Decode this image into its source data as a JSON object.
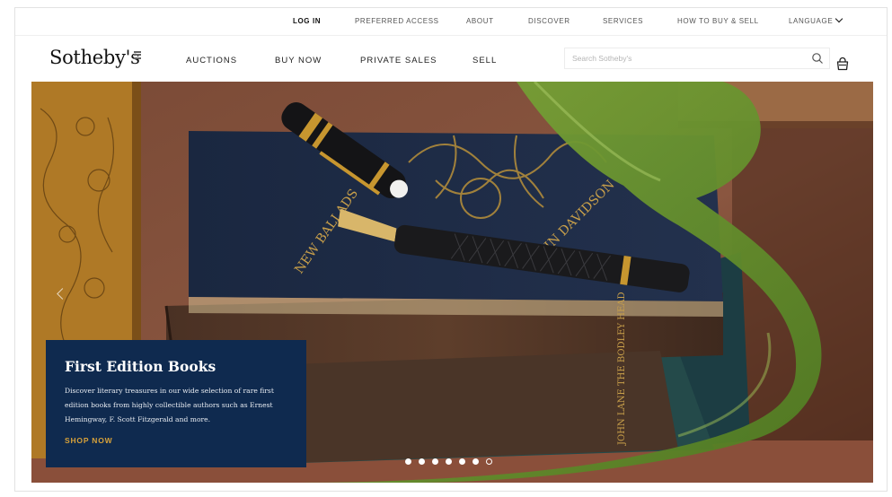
{
  "utility_nav": [
    {
      "label": "LOG IN"
    },
    {
      "label": "PREFERRED ACCESS"
    },
    {
      "label": "ABOUT"
    },
    {
      "label": "DISCOVER"
    },
    {
      "label": "SERVICES"
    },
    {
      "label": "HOW TO BUY & SELL"
    },
    {
      "label": "LANGUAGE"
    }
  ],
  "brand": {
    "name": "Sotheby's"
  },
  "main_nav": [
    {
      "label": "AUCTIONS"
    },
    {
      "label": "BUY NOW"
    },
    {
      "label": "PRIVATE SALES"
    },
    {
      "label": "SELL"
    }
  ],
  "search": {
    "placeholder": "Search Sotheby's",
    "icon": "search-icon"
  },
  "cart": {
    "icon": "shopping-bag-icon"
  },
  "hero": {
    "title": "First Edition Books",
    "description": "Discover literary treasures in our wide selection of rare first edition books from highly collectible authors such as Ernest Hemingway, F. Scott Fitzgerald and more.",
    "cta": "SHOP NOW",
    "book_spine_texts": [
      "NEW BALLADS",
      "JOHN DAVIDSON",
      "JOHN LANE THE BODLEY HEAD"
    ],
    "slides_total": 7,
    "active_slide": 7
  },
  "colors": {
    "card_bg": "#0f2a4f",
    "cta": "#d8a23a",
    "ribbon": "#6f9a2e"
  }
}
